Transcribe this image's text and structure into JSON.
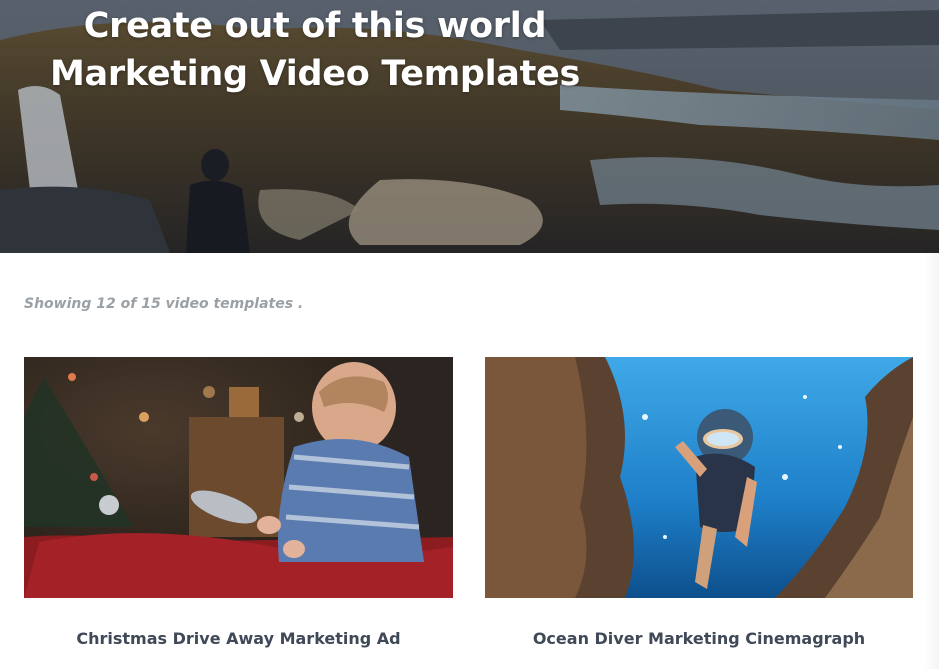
{
  "hero": {
    "title_line1": "Create out of this world",
    "title_line2": "Marketing Video Templates"
  },
  "listing": {
    "showing_text": "Showing 12 of 15 video templates ."
  },
  "templates": [
    {
      "title": "Christmas Drive Away Marketing Ad",
      "thumbnail": "baby-in-red-toy-car"
    },
    {
      "title": "Ocean Diver Marketing Cinemagraph",
      "thumbnail": "underwater-diver"
    }
  ],
  "colors": {
    "title_text": "#3f4957",
    "muted_text": "#9aa0a6",
    "hero_text": "#ffffff"
  }
}
